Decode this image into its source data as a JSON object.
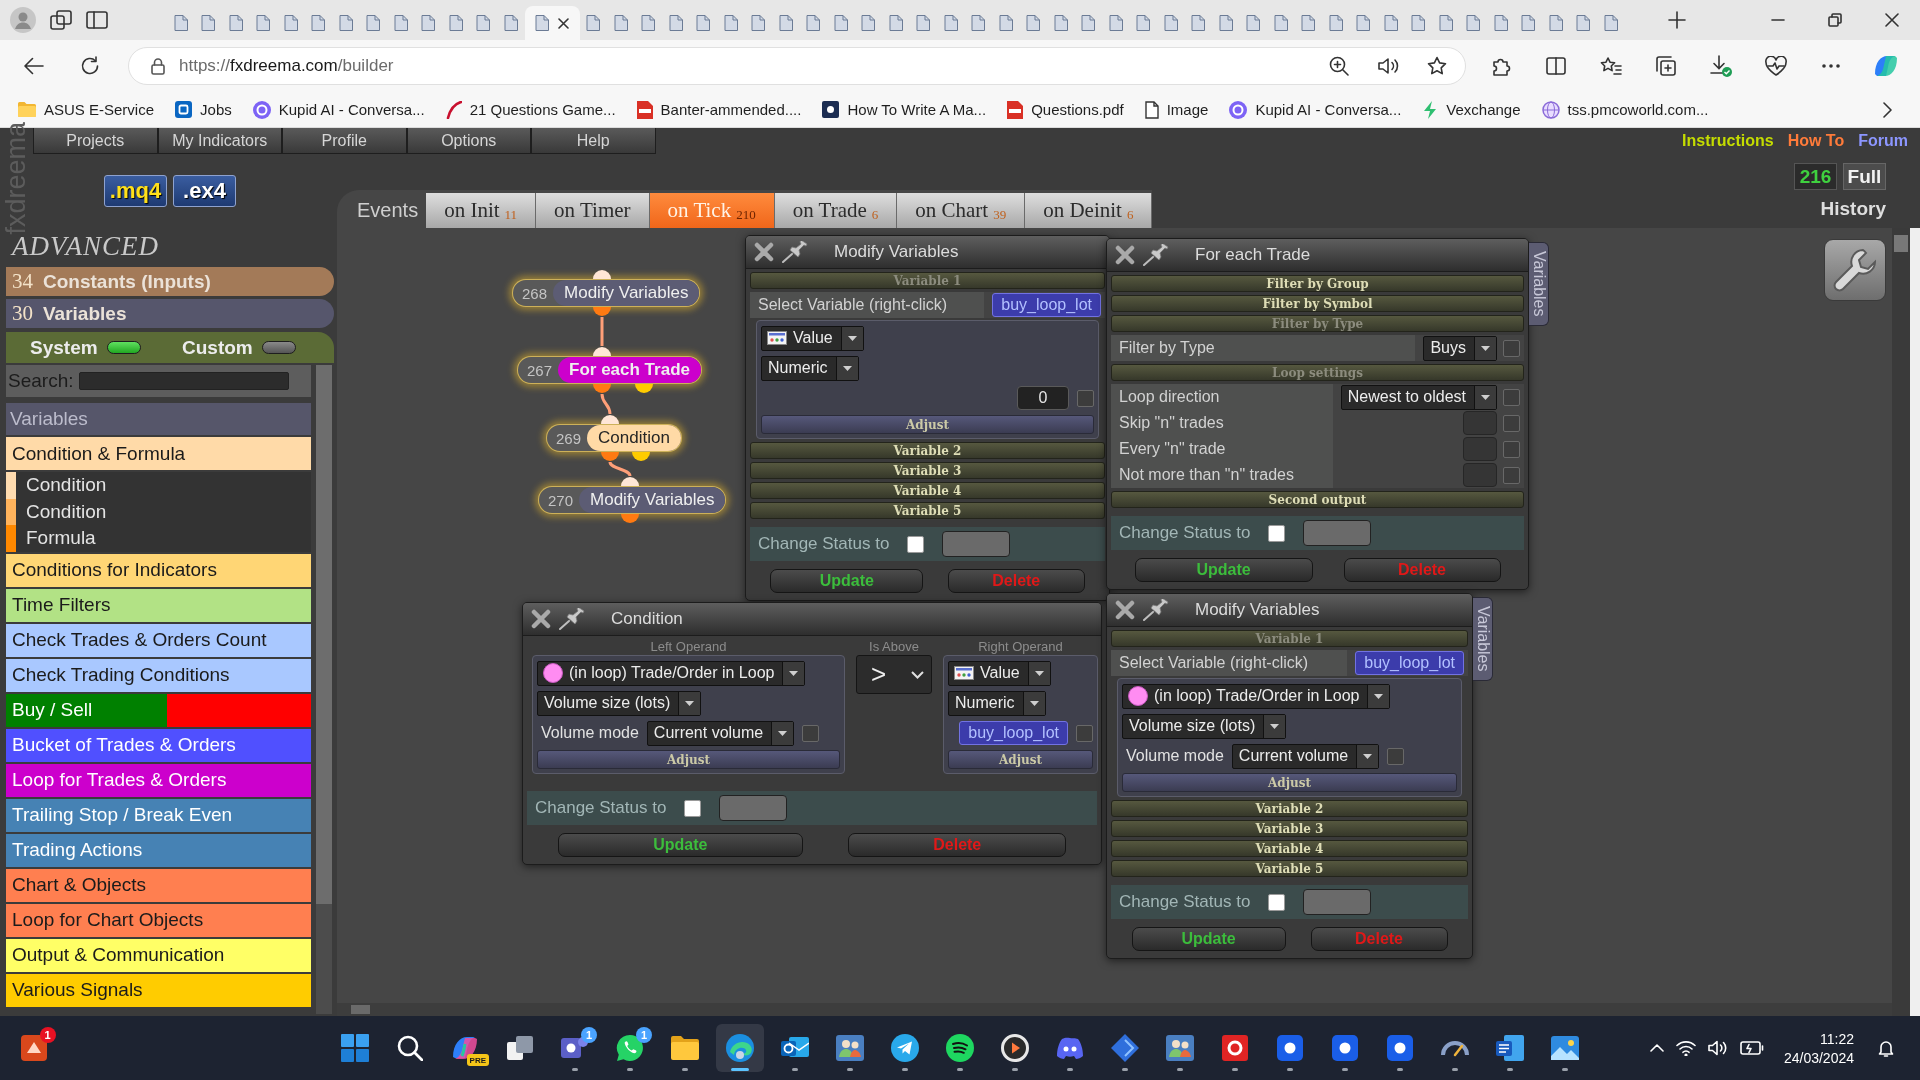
{
  "browser": {
    "tabs": [
      {
        "selected": false
      },
      {
        "selected": false
      },
      {
        "selected": false
      },
      {
        "selected": false
      },
      {
        "selected": false
      },
      {
        "selected": false
      },
      {
        "selected": false
      },
      {
        "selected": false
      },
      {
        "selected": false
      },
      {
        "selected": false
      },
      {
        "selected": false
      },
      {
        "selected": false
      },
      {
        "selected": false
      },
      {
        "selected": true
      },
      {
        "selected": false
      },
      {
        "selected": false
      },
      {
        "selected": false
      },
      {
        "selected": false
      },
      {
        "selected": false
      },
      {
        "selected": false
      },
      {
        "selected": false
      },
      {
        "selected": false
      },
      {
        "selected": false
      },
      {
        "selected": false
      },
      {
        "selected": false
      },
      {
        "selected": false
      },
      {
        "selected": false
      },
      {
        "selected": false
      },
      {
        "selected": false
      },
      {
        "selected": false
      },
      {
        "selected": false
      },
      {
        "selected": false
      },
      {
        "selected": false
      },
      {
        "selected": false
      },
      {
        "selected": false
      },
      {
        "selected": false
      },
      {
        "selected": false
      },
      {
        "selected": false
      },
      {
        "selected": false
      },
      {
        "selected": false
      },
      {
        "selected": false
      },
      {
        "selected": false
      },
      {
        "selected": false
      },
      {
        "selected": false
      },
      {
        "selected": false
      },
      {
        "selected": false
      },
      {
        "selected": false
      },
      {
        "selected": false
      },
      {
        "selected": false
      },
      {
        "selected": false
      },
      {
        "selected": false
      },
      {
        "selected": false
      }
    ],
    "address": {
      "scheme": "https://",
      "host": "fxdreema.com",
      "path": "/builder"
    },
    "bookmarks": [
      {
        "kind": "folder",
        "label": "ASUS E-Service"
      },
      {
        "kind": "square",
        "label": "Jobs"
      },
      {
        "kind": "circle",
        "label": "Kupid AI - Conversa..."
      },
      {
        "kind": "script",
        "label": "21 Questions Game..."
      },
      {
        "kind": "pdf",
        "label": "Banter-ammended...."
      },
      {
        "kind": "dark-square",
        "label": "How To Write A Ma..."
      },
      {
        "kind": "pdf",
        "label": "Questions.pdf"
      },
      {
        "kind": "page",
        "label": "Image"
      },
      {
        "kind": "circle",
        "label": "Kupid AI - Conversa..."
      },
      {
        "kind": "zigzag",
        "label": "Vexchange"
      },
      {
        "kind": "globe",
        "label": "tss.pmcoworld.com..."
      }
    ]
  },
  "app": {
    "logo": "fxdreema",
    "menu": [
      "Projects",
      "My Indicators",
      "Profile",
      "Options",
      "Help"
    ],
    "file_buttons": [
      {
        "label": ".mq4",
        "selected": true
      },
      {
        "label": ".ex4",
        "selected": false
      }
    ],
    "links": [
      {
        "label": "Instructions",
        "color": "#c4dc00"
      },
      {
        "label": "How To",
        "color": "#ff7b3a"
      },
      {
        "label": "Forum",
        "color": "#8c96ff"
      }
    ],
    "counter": "216",
    "mode_button": "Full",
    "history": "History",
    "events": {
      "label": "Events",
      "tabs": [
        {
          "label": "on Init",
          "count": "11",
          "selected": false
        },
        {
          "label": "on Timer",
          "selected": false
        },
        {
          "label": "on Tick",
          "count": "210",
          "selected": true
        },
        {
          "label": "on Trade",
          "count": "6",
          "selected": false
        },
        {
          "label": "on Chart",
          "count": "39",
          "selected": false
        },
        {
          "label": "on Deinit",
          "count": "6",
          "selected": false
        }
      ]
    },
    "sidebar": {
      "heading": "ADVANCED",
      "groups": [
        {
          "count": "34",
          "label": "Constants (Inputs)",
          "color": "#a37a58"
        },
        {
          "count": "30",
          "label": "Variables",
          "color": "#56566c"
        }
      ],
      "toggles": [
        {
          "label": "System",
          "on": true
        },
        {
          "label": "Custom",
          "on": false
        }
      ],
      "search_label": "Search:",
      "list_header": "Variables",
      "categories": [
        {
          "label": "Condition & Formula",
          "color": "#ffdaa8",
          "children": [
            {
              "label": "Condition",
              "color": "#ffdcb0"
            },
            {
              "label": "Condition",
              "color": "#ffb35c"
            },
            {
              "label": "Formula",
              "color": "#ff8800"
            }
          ]
        },
        {
          "label": "Conditions for Indicators",
          "color": "#ffd675"
        },
        {
          "label": "Time Filters",
          "color": "#b2e285"
        },
        {
          "label": "Check Trades & Orders Count",
          "color": "#a9c8ff"
        },
        {
          "label": "Check Trading Conditions",
          "color": "#a9c8ff"
        },
        {
          "label": "Buy / Sell",
          "color": "#008000",
          "split": {
            "color": "#ff0000"
          }
        },
        {
          "label": "Bucket of Trades & Orders",
          "color": "#5050ff"
        },
        {
          "label": "Loop for Trades & Orders",
          "color": "#cc00cc"
        },
        {
          "label": "Trailing Stop / Break Even",
          "color": "#4682b4"
        },
        {
          "label": "Trading Actions",
          "color": "#4682b4"
        },
        {
          "label": "Chart & Objects",
          "color": "#ff7f50"
        },
        {
          "label": "Loop for Chart Objects",
          "color": "#ff7f50"
        },
        {
          "label": "Output & Communication",
          "color": "#ffff66"
        },
        {
          "label": "Various Signals",
          "color": "#ffcc00"
        }
      ]
    },
    "canvas": {
      "nodes": [
        {
          "number": "268",
          "label": "Modify Variables",
          "color": "#5c5c74",
          "second_output": false
        },
        {
          "number": "267",
          "label": "For each Trade",
          "color": "#cc00cc",
          "second_output": true
        },
        {
          "number": "269",
          "label": "Condition",
          "color": "#ffdaa6",
          "second_output": true
        },
        {
          "number": "270",
          "label": "Modify Variables",
          "color": "#5c5c74",
          "second_output": false
        }
      ],
      "windows": [
        {
          "kind": "sections",
          "title": "Modify Variables",
          "sections": [
            {
              "title": "Variable 1",
              "expanded": true,
              "rows": [
                {
                  "kind": "chip",
                  "label": "Select Variable (right-click)",
                  "value": "buy_loop_lot"
                },
                {
                  "kind": "panel",
                  "items": [
                    {
                      "kind": "value_source",
                      "value": "Value"
                    },
                    {
                      "kind": "dropdown",
                      "value": "Numeric"
                    },
                    {
                      "kind": "number",
                      "value": "0",
                      "checked": false
                    }
                  ],
                  "adjust": "Adjust"
                }
              ]
            },
            {
              "title": "Variable 2",
              "expanded": false
            },
            {
              "title": "Variable 3",
              "expanded": false
            },
            {
              "title": "Variable 4",
              "expanded": false
            },
            {
              "title": "Variable 5",
              "expanded": false
            }
          ],
          "status": {
            "label": "Change Status to",
            "checked": false
          },
          "buttons": [
            {
              "kind": "update",
              "label": "Update"
            },
            {
              "kind": "delete",
              "label": "Delete"
            }
          ]
        },
        {
          "kind": "operands",
          "title": "Condition",
          "columns": [
            {
              "kind": "panel",
              "heading": "Left Operand",
              "items": [
                {
                  "kind": "loop_source",
                  "value": "(in loop) Trade/Order in Loop"
                },
                {
                  "kind": "dropdown",
                  "value": "Volume size (lots)"
                },
                {
                  "kind": "labeled_dropdown",
                  "label": "Volume mode",
                  "value": "Current volume",
                  "checked": false
                }
              ],
              "adjust": "Adjust"
            },
            {
              "kind": "operator",
              "heading": "Is Above",
              "value": ">"
            },
            {
              "kind": "panel",
              "heading": "Right Operand",
              "items": [
                {
                  "kind": "value_source",
                  "value": "Value"
                },
                {
                  "kind": "dropdown",
                  "value": "Numeric"
                },
                {
                  "kind": "chip",
                  "value": "buy_loop_lot",
                  "checked": false
                }
              ],
              "adjust": "Adjust"
            }
          ],
          "status": {
            "label": "Change Status to",
            "checked": false
          },
          "buttons": [
            {
              "kind": "update",
              "label": "Update"
            },
            {
              "kind": "delete",
              "label": "Delete"
            }
          ]
        },
        {
          "kind": "sections",
          "title": "For each Trade",
          "side_tab": "Variables",
          "sections": [
            {
              "title": "Filter by Group",
              "expanded": false
            },
            {
              "title": "Filter by Symbol",
              "expanded": false
            },
            {
              "title": "Filter by Type",
              "expanded": true,
              "rows": [
                {
                  "kind": "field_dropdown",
                  "label": "Filter by Type",
                  "value": "Buys",
                  "checked": false
                }
              ]
            },
            {
              "title": "Loop settings",
              "expanded": true,
              "rows": [
                {
                  "kind": "field_dropdown",
                  "label": "Loop direction",
                  "value": "Newest to oldest",
                  "checked": false
                },
                {
                  "kind": "field_input",
                  "label": "Skip \"n\" trades",
                  "checked": false
                },
                {
                  "kind": "field_input",
                  "label": "Every \"n\" trade",
                  "checked": false
                },
                {
                  "kind": "field_input",
                  "label": "Not more than \"n\" trades",
                  "checked": false
                }
              ]
            },
            {
              "title": "Second output",
              "expanded": false
            }
          ],
          "status": {
            "label": "Change Status to",
            "checked": false
          },
          "buttons": [
            {
              "kind": "update",
              "label": "Update"
            },
            {
              "kind": "delete",
              "label": "Delete"
            }
          ]
        },
        {
          "kind": "sections",
          "title": "Modify Variables",
          "side_tab": "Variables",
          "sections": [
            {
              "title": "Variable 1",
              "expanded": true,
              "rows": [
                {
                  "kind": "chip",
                  "label": "Select Variable (right-click)",
                  "value": "buy_loop_lot"
                },
                {
                  "kind": "panel",
                  "items": [
                    {
                      "kind": "loop_source",
                      "value": "(in loop) Trade/Order in Loop"
                    },
                    {
                      "kind": "dropdown",
                      "value": "Volume size (lots)"
                    },
                    {
                      "kind": "labeled_dropdown",
                      "label": "Volume mode",
                      "value": "Current volume",
                      "checked": false
                    }
                  ],
                  "adjust": "Adjust"
                }
              ]
            },
            {
              "title": "Variable 2",
              "expanded": false
            },
            {
              "title": "Variable 3",
              "expanded": false
            },
            {
              "title": "Variable 4",
              "expanded": false
            },
            {
              "title": "Variable 5",
              "expanded": false
            }
          ],
          "status": {
            "label": "Change Status to",
            "checked": false
          },
          "buttons": [
            {
              "kind": "update",
              "label": "Update"
            },
            {
              "kind": "delete",
              "label": "Delete"
            }
          ]
        }
      ]
    }
  },
  "taskbar": {
    "notification_app": {
      "badge": {
        "text": "1",
        "color": "#e81123"
      }
    },
    "apps": [
      {
        "kind": "grid",
        "selected": false,
        "running": false
      },
      {
        "kind": "search",
        "selected": false,
        "running": false
      },
      {
        "kind": "swirl",
        "badge": {
          "text": "PRE",
          "color": "#f5c518"
        },
        "selected": false,
        "running": false
      },
      {
        "kind": "windows",
        "selected": false,
        "running": false
      },
      {
        "kind": "people-tile",
        "badge": {
          "text": "1",
          "color": "#4aa3ff"
        },
        "selected": false,
        "running": true
      },
      {
        "kind": "chat",
        "badge": {
          "text": "1",
          "color": "#4aa3ff"
        },
        "selected": false,
        "running": true
      },
      {
        "kind": "folder",
        "selected": false,
        "running": true
      },
      {
        "kind": "browser",
        "selected": true,
        "running": true
      },
      {
        "kind": "mail",
        "selected": false,
        "running": true
      },
      {
        "kind": "people",
        "selected": false,
        "running": true
      },
      {
        "kind": "plane",
        "selected": false,
        "running": true
      },
      {
        "kind": "waves",
        "selected": false,
        "running": true
      },
      {
        "kind": "play",
        "selected": false,
        "running": true
      },
      {
        "kind": "gamepad",
        "selected": false,
        "running": true
      },
      {
        "kind": "diamond",
        "selected": false,
        "running": true
      },
      {
        "kind": "people",
        "selected": false,
        "running": true
      },
      {
        "kind": "red-tile",
        "selected": false,
        "running": true
      },
      {
        "kind": "blue-tile",
        "selected": false,
        "running": true
      },
      {
        "kind": "blue-tile",
        "selected": false,
        "running": true
      },
      {
        "kind": "blue-tile",
        "selected": false,
        "running": true
      },
      {
        "kind": "gauge",
        "selected": false,
        "running": true
      },
      {
        "kind": "doc",
        "selected": false,
        "running": true
      },
      {
        "kind": "photo",
        "selected": false,
        "running": true
      }
    ],
    "tray": {
      "time": "11:22",
      "date": "24/03/2024"
    }
  }
}
